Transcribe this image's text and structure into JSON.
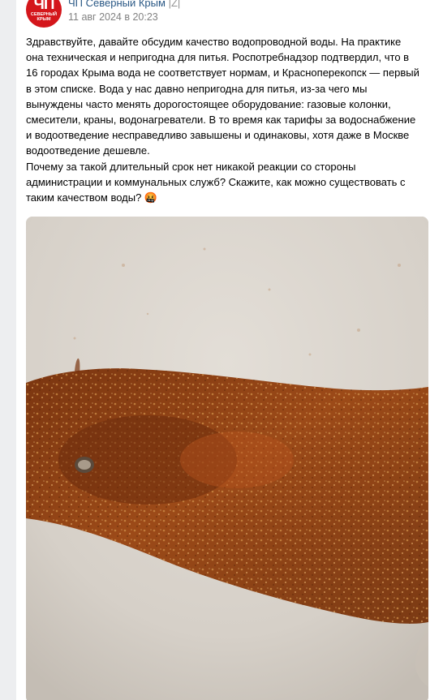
{
  "post": {
    "avatar_text": "ЧП",
    "avatar_subtext": "СЕВЕРНЫЙ КРЫМ",
    "author": "ЧП Северный Крым ",
    "author_tag": "|Z|",
    "date": "11 авг 2024 в 20:23",
    "text": "Здравствуйте, давайте обсудим качество водопроводной воды. На практике\nона техническая и непригодна для питья. Роспотребнадзор подтвердил, что в\n16 городах Крыма вода не соответствует нормам, и Красноперекопск — первый\nв этом списке. Вода у нас давно непригодна для питья, из-за чего мы\nвынуждены часто менять дорогостоящее оборудование: газовые колонки,\nсмесители, краны, водонагреватели. В то время как тарифы за водоснабжение\nи водоотведение несправедливо завышены и одинаковы, хотя даже в Москве\nводоотведение дешевле.\nПочему за такой длительный срок нет никакой реакции со стороны\nадминистрации и коммунальных служб? Скажите, как можно существовать с\nтаким качеством воды? 🤬"
  },
  "colors": {
    "link": "#2a5885",
    "muted": "#828282",
    "avatar_bg": "#d4161b",
    "rust": "#8a3f12",
    "tub": "#ddd8d1"
  }
}
